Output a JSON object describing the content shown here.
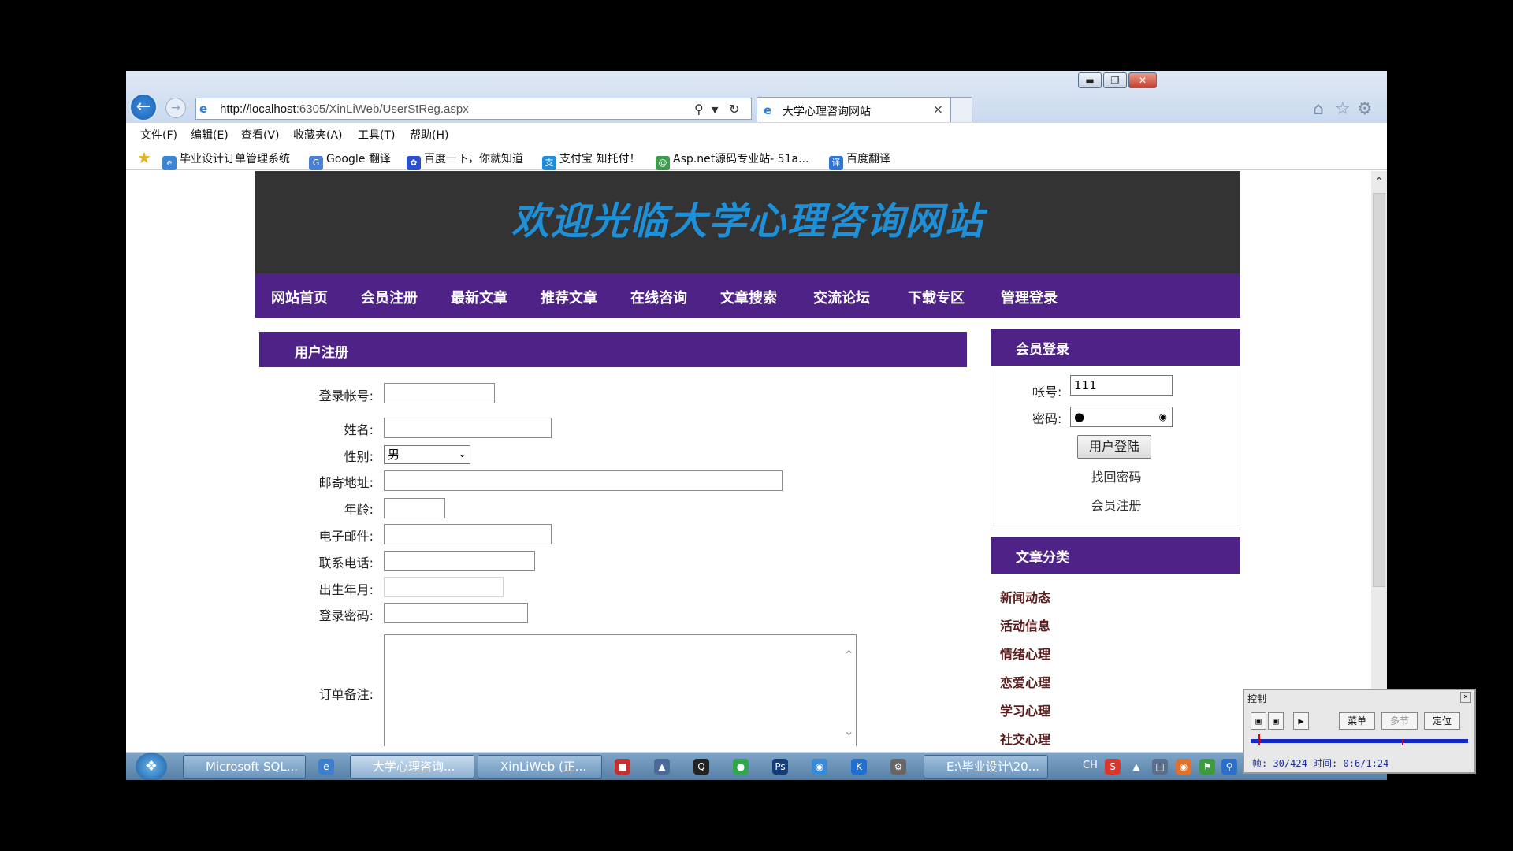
{
  "browser": {
    "window_controls": {
      "minimize": "▬",
      "restore": "❐",
      "close": "✕"
    },
    "url_host": "http://localhost",
    "url_rest": ":6305/XinLiWeb/UserStReg.aspx",
    "tab_title": "大学心理咨询网站",
    "menu": [
      "文件(F)",
      "编辑(E)",
      "查看(V)",
      "收藏夹(A)",
      "工具(T)",
      "帮助(H)"
    ],
    "favorites": [
      "毕业设计订单管理系统",
      "Google 翻译",
      "百度一下，你就知道",
      "支付宝 知托付！",
      "Asp.net源码专业站- 51a...",
      "百度翻译"
    ]
  },
  "site": {
    "banner": "欢迎光临大学心理咨询网站",
    "nav": [
      "网站首页",
      "会员注册",
      "最新文章",
      "推荐文章",
      "在线咨询",
      "文章搜索",
      "交流论坛",
      "下载专区",
      "管理登录"
    ]
  },
  "register": {
    "title": "用户注册",
    "labels": {
      "account": "登录帐号:",
      "name": "姓名:",
      "gender": "性别:",
      "address": "邮寄地址:",
      "age": "年龄:",
      "email": "电子邮件:",
      "phone": "联系电话:",
      "birth": "出生年月:",
      "password": "登录密码:",
      "remarks": "订单备注:"
    },
    "gender_value": "男"
  },
  "login": {
    "title": "会员登录",
    "account_label": "帐号:",
    "password_label": "密码:",
    "account_value": "111",
    "password_value": "●",
    "button": "用户登陆",
    "forgot": "找回密码",
    "register": "会员注册"
  },
  "categories": {
    "title": "文章分类",
    "items": [
      "新闻动态",
      "活动信息",
      "情绪心理",
      "恋爱心理",
      "学习心理",
      "社交心理"
    ]
  },
  "taskbar": {
    "tasks": [
      "Microsoft SQL...",
      "大学心理咨询...",
      "XinLiWeb (正...",
      "E:\\毕业设计\\20..."
    ],
    "ime": "CH"
  },
  "player": {
    "title": "控制",
    "buttons": [
      "菜单",
      "多节",
      "定位"
    ],
    "status": "帧: 30/424 时间: 0:6/1:24"
  },
  "colors": {
    "nav_purple": "#4e2287",
    "banner_bg": "#333333",
    "banner_text": "#1f90d8"
  }
}
